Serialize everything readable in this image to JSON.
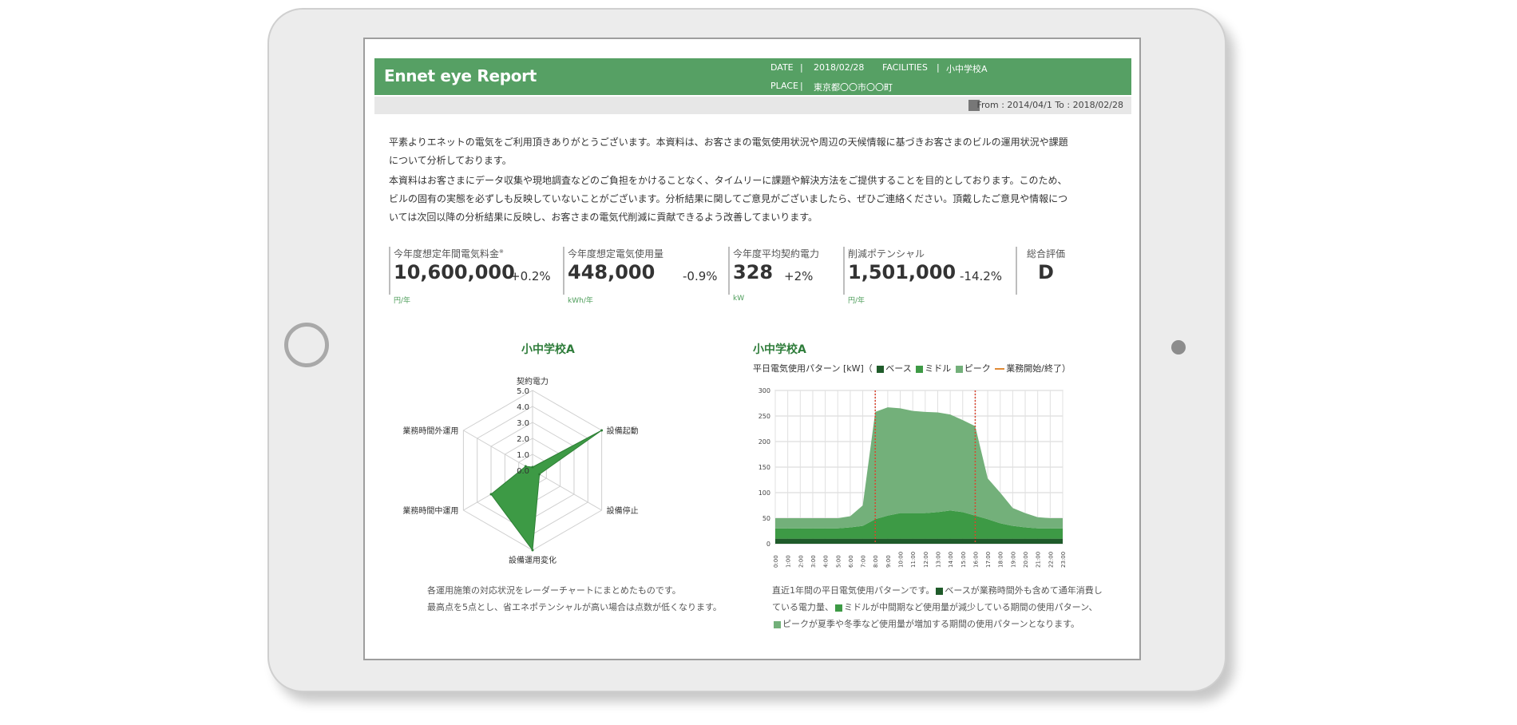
{
  "report": {
    "title": "Ennet eye Report",
    "date_label": "DATE",
    "date_value": "2018/02/28",
    "facilities_label": "FACILITIES",
    "facilities_value": "小中学校A",
    "place_label": "PLACE",
    "place_value": "東京都〇〇市〇〇町",
    "period": "From : 2014/04/1  To : 2018/02/28",
    "intro_1": "平素よりエネットの電気をご利用頂きありがとうございます。本資料は、お客さまの電気使用状況や周辺の天候情報に基づきお客さまのビルの運用状況や課題について分析しております。",
    "intro_2": "本資料はお客さまにデータ収集や現地調査などのご負担をかけることなく、タイムリーに課題や解決方法をご提供することを目的としております。このため、ビルの固有の実態を必ずしも反映していないことがございます。分析結果に関してご意見がございましたら、ぜひご連絡ください。頂戴したご意見や情報については次回以降の分析結果に反映し、お客さまの電気代削減に貢献できるよう改善してまいります。"
  },
  "kpis": [
    {
      "label": "今年度想定年間電気料金",
      "note": "※",
      "value": "10,600,000",
      "change": "+0.2%",
      "unit": "円/年"
    },
    {
      "label": "今年度想定電気使用量",
      "value": "448,000",
      "change": "-0.9%",
      "unit": "kWh/年"
    },
    {
      "label": "今年度平均契約電力",
      "value": "328",
      "change": "+2%",
      "unit": "kW"
    },
    {
      "label": "削減ポテンシャル",
      "value": "1,501,000",
      "change": "-14.2%",
      "unit": "円/年"
    },
    {
      "label": "総合評価",
      "value": "D"
    }
  ],
  "radar": {
    "title": "小中学校A",
    "caption_1": "各運用施策の対応状況をレーダーチャートにまとめたものです。",
    "caption_2": "最高点を5点とし、省エネポテンシャルが高い場合は点数が低くなります。"
  },
  "pattern": {
    "title": "小中学校A",
    "legend_prefix": "平日電気使用パターン [kW]（",
    "legend_base": "ベース",
    "legend_middle": "ミドル",
    "legend_peak": "ピーク",
    "legend_ops": "業務開始/終了",
    "legend_suffix": "）",
    "caption_1": "直近1年間の平日電気使用パターンです。",
    "caption_1b": "ベースが業務時間外も含めて通年消費し",
    "caption_2": "ている電力量、",
    "caption_2b": "ミドルが中間期など使用量が減少している期間の使用パターン、",
    "caption_3": "ピークが夏季や冬季など使用量が増加する期間の使用パターンとなります。"
  },
  "chart_data": [
    {
      "type": "radar",
      "title": "小中学校A",
      "axes": [
        "契約電力",
        "設備起動",
        "設備停止",
        "設備運用変化",
        "業務時間中運用",
        "業務時間外運用"
      ],
      "scale_labels": [
        "0.0",
        "1.0",
        "2.0",
        "3.0",
        "4.0",
        "5.0"
      ],
      "range": [
        0,
        5
      ],
      "series": [
        {
          "values": [
            0.2,
            5.0,
            0.5,
            5.0,
            3.0,
            0.5
          ]
        }
      ],
      "colors": {
        "fill": "#3d9a45",
        "grid": "#cfcfcf"
      }
    },
    {
      "type": "area",
      "title": "小中学校A",
      "ylabel": "平日電気使用パターン [kW]",
      "ylim": [
        0,
        300
      ],
      "yticks": [
        0,
        50,
        100,
        150,
        200,
        250,
        300
      ],
      "x": [
        "0:00",
        "1:00",
        "2:00",
        "3:00",
        "4:00",
        "5:00",
        "6:00",
        "7:00",
        "8:00",
        "9:00",
        "10:00",
        "11:00",
        "12:00",
        "13:00",
        "14:00",
        "15:00",
        "16:00",
        "17:00",
        "18:00",
        "19:00",
        "20:00",
        "21:00",
        "22:00",
        "23:00"
      ],
      "series": [
        {
          "name": "ベース",
          "values": [
            10,
            10,
            10,
            10,
            10,
            10,
            10,
            10,
            10,
            10,
            10,
            10,
            10,
            10,
            10,
            10,
            10,
            10,
            10,
            10,
            10,
            10,
            10,
            10
          ],
          "color": "#1f5b2a"
        },
        {
          "name": "ミドル",
          "values": [
            20,
            20,
            20,
            20,
            20,
            20,
            22,
            25,
            38,
            45,
            50,
            50,
            50,
            52,
            55,
            52,
            45,
            38,
            30,
            25,
            22,
            20,
            20,
            20
          ],
          "color": "#3d9a45"
        },
        {
          "name": "ピーク",
          "values": [
            20,
            20,
            20,
            20,
            20,
            20,
            22,
            40,
            210,
            212,
            205,
            200,
            198,
            195,
            188,
            180,
            175,
            80,
            60,
            35,
            28,
            22,
            20,
            20
          ],
          "color": "#73b07a"
        }
      ],
      "markers": {
        "name": "業務開始/終了",
        "x": [
          "8:00",
          "16:00"
        ],
        "color": "#d9442f"
      }
    }
  ]
}
